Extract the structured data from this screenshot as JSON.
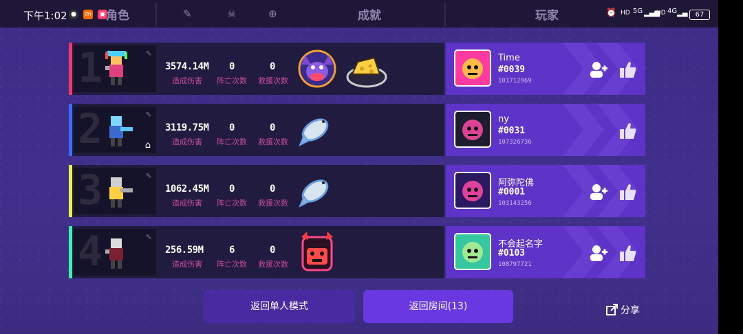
{
  "status": {
    "time": "下午1:02",
    "battery": "67",
    "network_a": "5G",
    "network_b": "4G",
    "hd": "HD"
  },
  "tabs": {
    "role": "角色",
    "achievements": "成就",
    "players": "玩家"
  },
  "labels": {
    "damage": "造成伤害",
    "deaths": "阵亡次数",
    "rescues": "救援次数"
  },
  "rows": [
    {
      "rank": "1",
      "damage": "3574.14M",
      "deaths": "0",
      "rescues": "0",
      "name": "Time",
      "number": "#0039",
      "id": "101712969",
      "accent": "#f0386b",
      "is_host": false
    },
    {
      "rank": "2",
      "damage": "3119.75M",
      "deaths": "0",
      "rescues": "0",
      "name": "ny",
      "number": "#0031",
      "id": "107326736",
      "accent": "#3b6bff",
      "is_host": true
    },
    {
      "rank": "3",
      "damage": "1062.45M",
      "deaths": "0",
      "rescues": "0",
      "name": "阿弥陀佛",
      "number": "#0001",
      "id": "103143256",
      "accent": "#e8f04a",
      "is_host": false
    },
    {
      "rank": "4",
      "damage": "256.59M",
      "deaths": "6",
      "rescues": "0",
      "name": "不会起名字",
      "number": "#0103",
      "id": "108797721",
      "accent": "#3cf0b0",
      "is_host": false
    }
  ],
  "buttons": {
    "single": "返回单人模式",
    "room": "返回房间(13)",
    "share": "分享"
  },
  "colors": {
    "card": "#5e34c8",
    "row": "#211c3f",
    "stat_label": "#c94aa0"
  }
}
